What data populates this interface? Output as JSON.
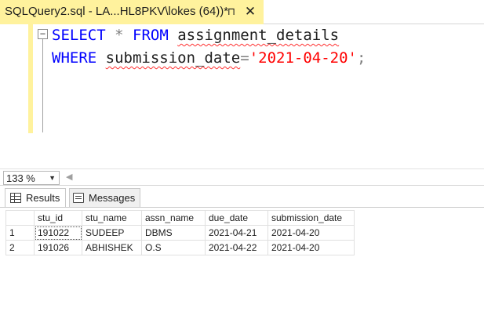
{
  "tab": {
    "title": "SQLQuery2.sql - LA...HL8PKV\\lokes (64))*",
    "pin_glyph": "⊓",
    "close_glyph": "✕"
  },
  "editor": {
    "collapse_glyph": "−",
    "line1": {
      "kw1": "SELECT",
      "op": "*",
      "kw2": "FROM",
      "ident": "assignment_details"
    },
    "line2": {
      "kw": "WHERE",
      "ident": "submission_date",
      "op": "=",
      "str": "'2021-04-20'",
      "semi": ";"
    }
  },
  "zoom": {
    "value": "133 %"
  },
  "results_tabs": {
    "results_label": "Results",
    "messages_label": "Messages"
  },
  "grid": {
    "columns": [
      "stu_id",
      "stu_name",
      "assn_name",
      "due_date",
      "submission_date"
    ],
    "rows": [
      {
        "num": "1",
        "cells": [
          "191022",
          "SUDEEP",
          "DBMS",
          "2021-04-21",
          "2021-04-20"
        ]
      },
      {
        "num": "2",
        "cells": [
          "191026",
          "ABHISHEK",
          "O.S",
          "2021-04-22",
          "2021-04-20"
        ]
      }
    ]
  }
}
